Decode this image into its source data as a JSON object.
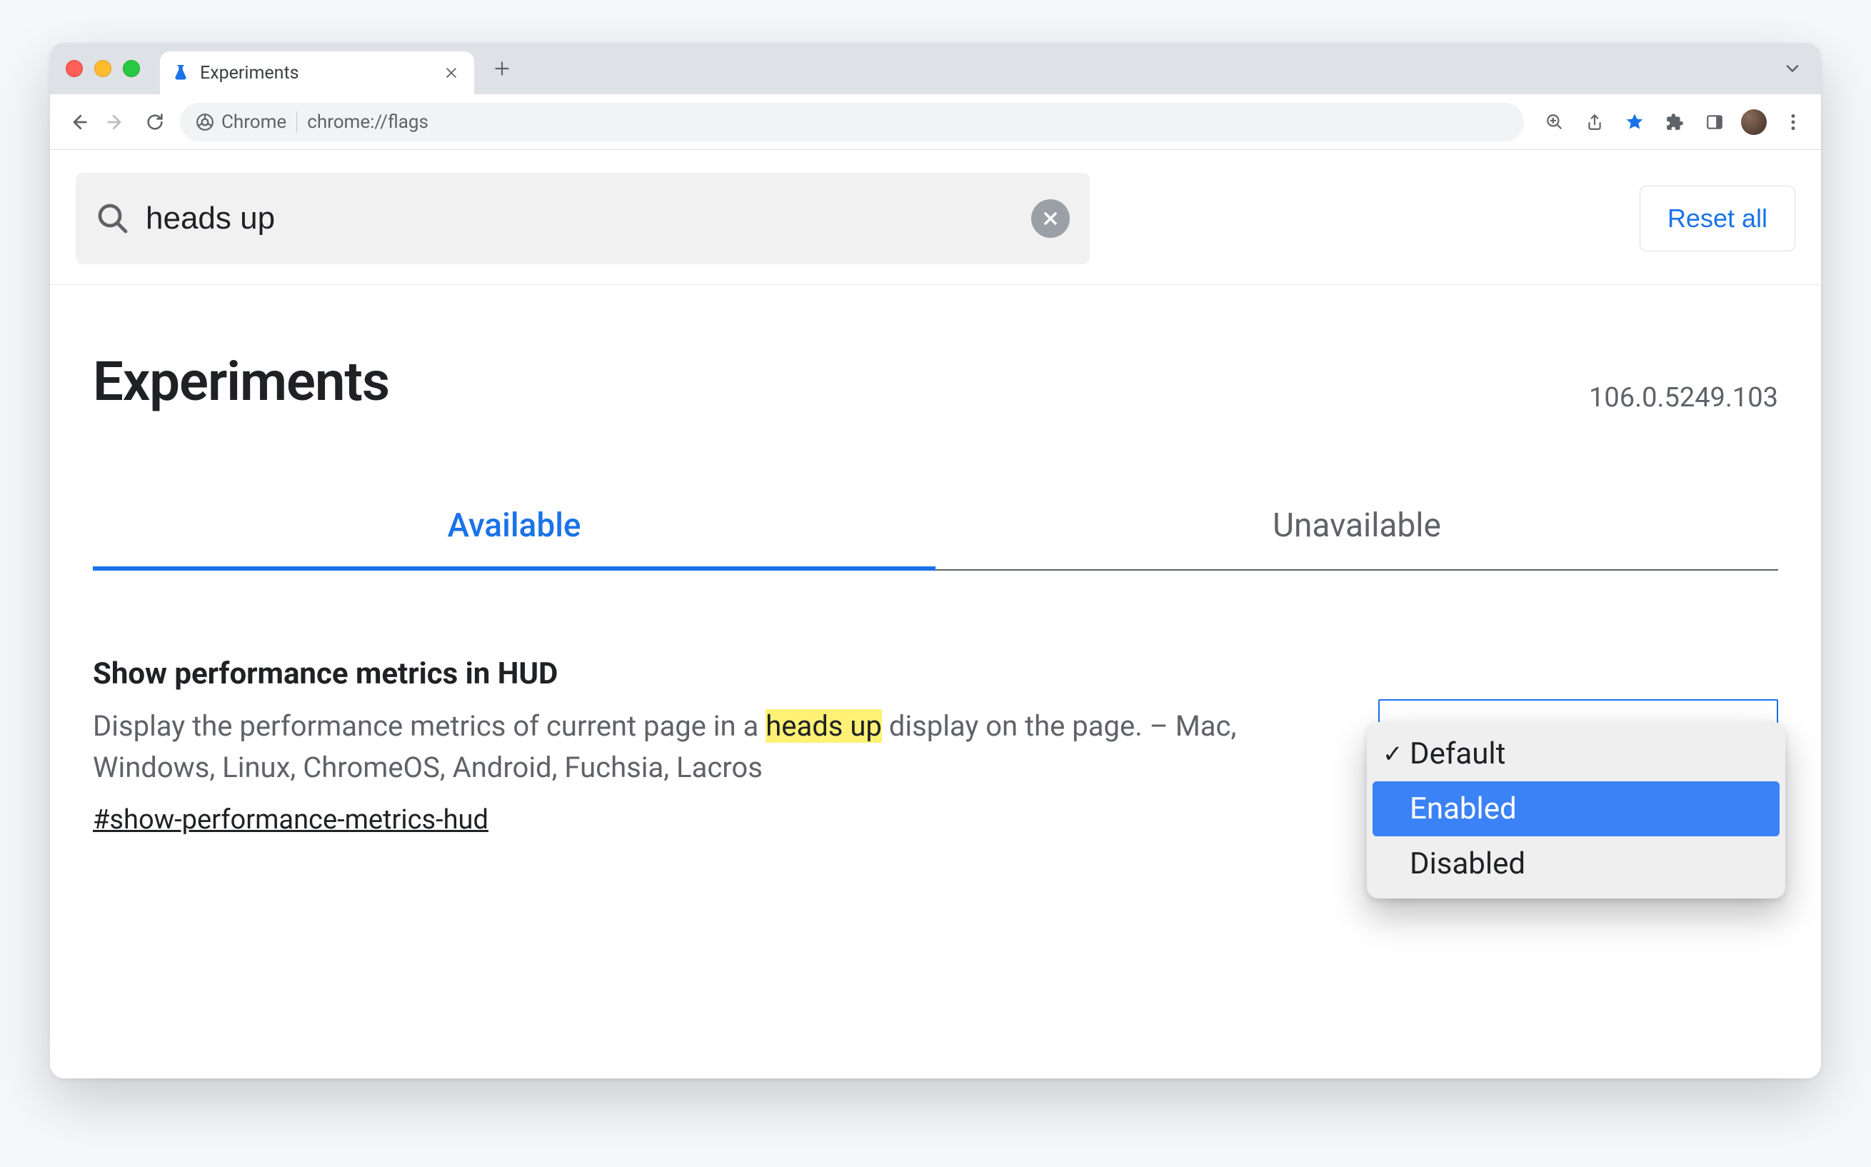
{
  "browser": {
    "tab": {
      "title": "Experiments"
    },
    "omnibox": {
      "chip_label": "Chrome",
      "url": "chrome://flags"
    }
  },
  "search": {
    "value": "heads up",
    "reset_label": "Reset all"
  },
  "header": {
    "title": "Experiments",
    "version": "106.0.5249.103"
  },
  "tabs": {
    "available": "Available",
    "unavailable": "Unavailable"
  },
  "flag": {
    "title": "Show performance metrics in HUD",
    "desc_before": "Display the performance metrics of current page in a ",
    "desc_highlight": "heads up",
    "desc_after": " display on the page. – Mac, Windows, Linux, ChromeOS, Android, Fuchsia, Lacros",
    "anchor": "#show-performance-metrics-hud",
    "options": {
      "default": "Default",
      "enabled": "Enabled",
      "disabled": "Disabled"
    }
  }
}
